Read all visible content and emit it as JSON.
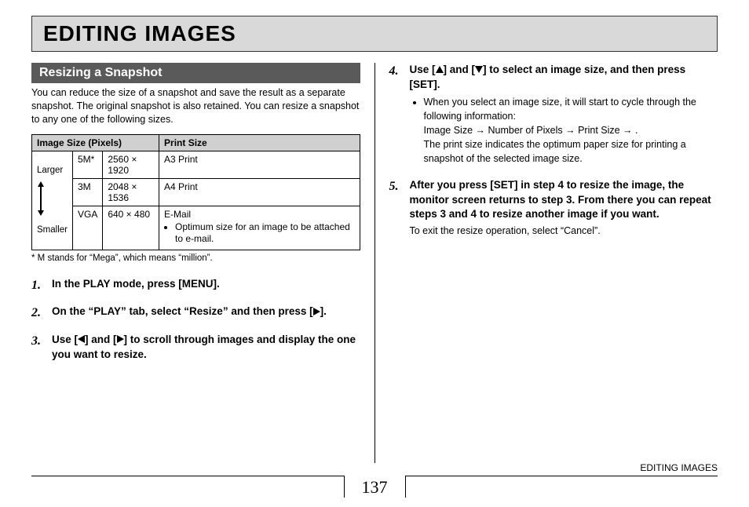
{
  "page_title": "EDITING IMAGES",
  "section_title": "Resizing a Snapshot",
  "intro_text": "You can reduce the size of a snapshot and save the result as a separate snapshot. The original snapshot is also retained. You can resize a snapshot to any one of the following sizes.",
  "table": {
    "headers": [
      "Image Size (Pixels)",
      "Print Size"
    ],
    "side": {
      "top": "Larger",
      "bottom": "Smaller"
    },
    "rows": [
      {
        "label": "5M*",
        "pixels": "2560 × 1920",
        "print": "A3 Print"
      },
      {
        "label": "3M",
        "pixels": "2048 × 1536",
        "print": "A4 Print"
      },
      {
        "label": "VGA",
        "pixels": "640 × 480",
        "print_title": "E-Mail",
        "print_note": "Optimum size for an image to be attached to e-mail."
      }
    ]
  },
  "footnote": "*  M stands for “Mega”, which means “million”.",
  "steps_left": [
    {
      "n": "1.",
      "main": "In the PLAY mode, press [MENU]."
    },
    {
      "n": "2.",
      "main_pre": "On the “PLAY” tab, select “Resize” and then press [",
      "main_post": "]."
    },
    {
      "n": "3.",
      "main_pre": "Use [",
      "main_mid": "] and [",
      "main_post": "] to scroll through images and display the one you want to resize."
    }
  ],
  "steps_right": [
    {
      "n": "4.",
      "main_pre": "Use [",
      "main_mid": "] and [",
      "main_post": "] to select an image size, and then press [SET].",
      "bullets": [
        "When you select an image size, it will start to cycle through the following information:",
        "Image Size → Number of Pixels → Print Size → .",
        "The print size indicates the optimum paper size for printing a snapshot of the selected image size."
      ]
    },
    {
      "n": "5.",
      "main": "After you press [SET] in step 4 to resize the image, the monitor screen returns to step 3. From there you can repeat steps 3 and 4 to resize another image if you want.",
      "sub": "To exit the resize operation, select “Cancel”."
    }
  ],
  "footer": {
    "page_number": "137",
    "section": "EDITING IMAGES"
  }
}
